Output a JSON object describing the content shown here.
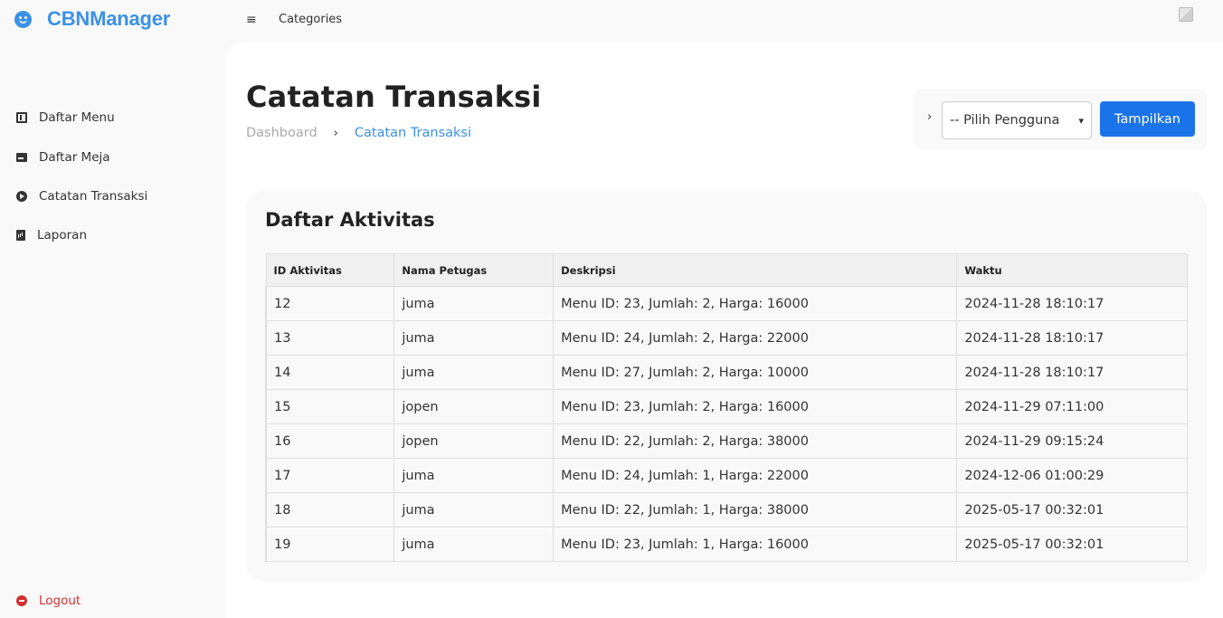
{
  "brand": {
    "name": "CBNManager",
    "icon": "smile-icon"
  },
  "header": {
    "menu_icon": "≡",
    "categories_label": "Categories"
  },
  "sidebar": {
    "items": [
      {
        "label": "Daftar Menu",
        "icon": "book-icon"
      },
      {
        "label": "Daftar Meja",
        "icon": "mail-icon"
      },
      {
        "label": "Catatan Transaksi",
        "icon": "arrow-circle-icon"
      },
      {
        "label": "Laporan",
        "icon": "report-icon"
      }
    ],
    "logout_label": "Logout"
  },
  "page": {
    "title": "Catatan Transaksi",
    "breadcrumb": {
      "home": "Dashboard",
      "separator": "›",
      "active": "Catatan Transaksi"
    }
  },
  "filter": {
    "chevron": "›",
    "select_value": "-- Pilih Pengguna",
    "submit_label": "Tampilkan"
  },
  "activity": {
    "title": "Daftar Aktivitas",
    "columns": [
      "ID Aktivitas",
      "Nama Petugas",
      "Deskripsi",
      "Waktu"
    ],
    "rows": [
      [
        "12",
        "juma",
        "Menu ID: 23, Jumlah: 2, Harga: 16000",
        "2024-11-28 18:10:17"
      ],
      [
        "13",
        "juma",
        "Menu ID: 24, Jumlah: 2, Harga: 22000",
        "2024-11-28 18:10:17"
      ],
      [
        "14",
        "juma",
        "Menu ID: 27, Jumlah: 2, Harga: 10000",
        "2024-11-28 18:10:17"
      ],
      [
        "15",
        "jopen",
        "Menu ID: 23, Jumlah: 2, Harga: 16000",
        "2024-11-29 07:11:00"
      ],
      [
        "16",
        "jopen",
        "Menu ID: 22, Jumlah: 2, Harga: 38000",
        "2024-11-29 09:15:24"
      ],
      [
        "17",
        "juma",
        "Menu ID: 24, Jumlah: 1, Harga: 22000",
        "2024-12-06 01:00:29"
      ],
      [
        "18",
        "juma",
        "Menu ID: 22, Jumlah: 1, Harga: 38000",
        "2025-05-17 00:32:01"
      ],
      [
        "19",
        "juma",
        "Menu ID: 23, Jumlah: 1, Harga: 16000",
        "2025-05-17 00:32:01"
      ]
    ]
  },
  "colors": {
    "accent": "#3c91e6",
    "primary_button": "#1a73e8",
    "logout": "#d32f2f"
  }
}
